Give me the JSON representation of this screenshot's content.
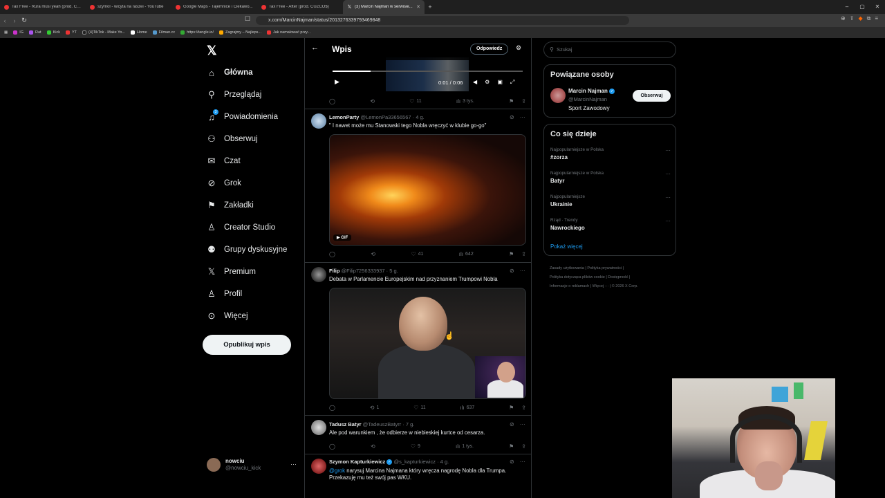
{
  "browser": {
    "tabs": [
      {
        "title": "Tax Free - Rura musi yeah (prod. CU..."
      },
      {
        "title": "szymol - wicyta na raszei - YouTube"
      },
      {
        "title": "Google Maps - Tajemnice i Ciekawo..."
      },
      {
        "title": "Tax Free - After (prod. CUZCO$)"
      },
      {
        "title": "(3) Marcin Najman w serwisie..."
      }
    ],
    "url": "x.com/MarcinNajman/status/2013276339793469848",
    "bookmarks": [
      "IG",
      "Rat",
      "Kick",
      "YT",
      "(4)TikTok - Make Yo...",
      "Home",
      "Filman.cc",
      "https://tangle.io/",
      "Zagrajmy – Najleps...",
      "Jak namalować przy..."
    ]
  },
  "sidebar": {
    "nav": [
      {
        "label": "Główna",
        "icon": "home-icon"
      },
      {
        "label": "Przeglądaj",
        "icon": "search-icon"
      },
      {
        "label": "Powiadomienia",
        "icon": "bell-icon"
      },
      {
        "label": "Obserwuj",
        "icon": "follow-icon"
      },
      {
        "label": "Czat",
        "icon": "mail-icon"
      },
      {
        "label": "Grok",
        "icon": "grok-icon"
      },
      {
        "label": "Zakładki",
        "icon": "bookmark-icon"
      },
      {
        "label": "Creator Studio",
        "icon": "creator-icon"
      },
      {
        "label": "Grupy dyskusyjne",
        "icon": "groups-icon"
      },
      {
        "label": "Premium",
        "icon": "x-icon"
      },
      {
        "label": "Profil",
        "icon": "profile-icon"
      },
      {
        "label": "Więcej",
        "icon": "more-icon"
      }
    ],
    "notifications_badge": "3",
    "post_button": "Opublikuj wpis",
    "account": {
      "name": "nowciu",
      "handle": "@nowciu_kick"
    }
  },
  "main": {
    "title": "Wpis",
    "reply_button": "Odpowiedz",
    "video": {
      "time": "0:01 / 0:06",
      "progress": 0.2
    },
    "video_actions": {
      "likes": "11",
      "views": "3 tys."
    },
    "tweets": [
      {
        "name": "LemonParty",
        "handle": "@LemonPa33656567 · 4 g.",
        "text": "\" I nawet może mu Stanowski tego Nobla wręczyć w klubie go-go\"",
        "media_badge": "GIF",
        "retweets": "",
        "likes": "41",
        "views": "642"
      },
      {
        "name": "Filip",
        "handle": "@Filip7256333937 · 5 g.",
        "text": "Debata w Parlamencie Europejskim nad przyznaniem Trumpowi Nobla",
        "retweets": "1",
        "likes": "11",
        "views": "637"
      },
      {
        "name": "Tadusz Batyr",
        "handle": "@TadeuszBatyrr · 7 g.",
        "text": "Ale pod warunkiem , że odbierze w niebieskiej kurtce od cesarza.",
        "likes": "9",
        "views": "1 tys."
      },
      {
        "name": "Szymon Kapturkiewicz",
        "handle": "@s_kapturkiewicz · 4 g.",
        "mention": "@grok",
        "text": " narysuj Marcina Najmana który wręcza nagrodę Nobla dla Trumpa. Przekazuję mu też swój pas WKU."
      }
    ]
  },
  "right": {
    "search_placeholder": "Szukaj",
    "related": {
      "title": "Powiązane osoby",
      "name": "Marcin Najman",
      "handle": "@MarcinNajman",
      "bio": "Sport Zawodowy",
      "follow": "Obserwuj"
    },
    "trends": {
      "title": "Co się dzieje",
      "items": [
        {
          "context": "Najpopularniejsze w Polska",
          "name": "#zorza"
        },
        {
          "context": "Najpopularniejsze w Polska",
          "name": "Batyr"
        },
        {
          "context": "Najpopularniejsze",
          "name": "Ukrainie"
        },
        {
          "context": "Rząd · Trendy",
          "name": "Nawrockiego"
        }
      ],
      "show_more": "Pokaż więcej"
    },
    "footer": [
      "Zasady użytkowania",
      "Polityka prywatności",
      "Polityka dotycząca plików cookie",
      "Dostępność",
      "Informacje o reklamach",
      "Więcej ···",
      "© 2026 X Corp."
    ]
  }
}
